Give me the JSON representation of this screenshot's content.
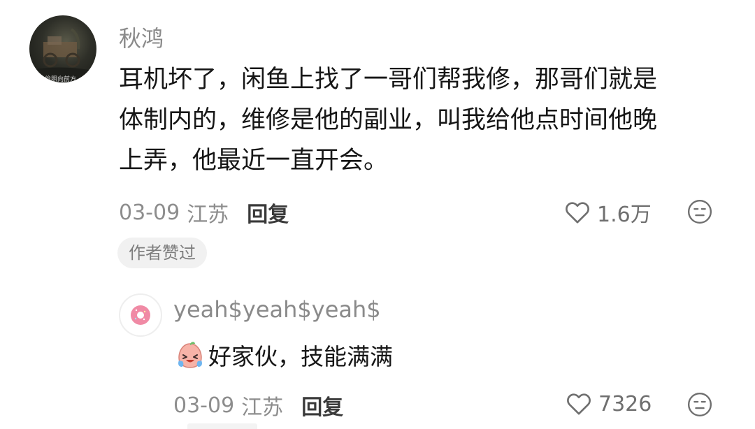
{
  "comment": {
    "username": "秋鸿",
    "avatar_watermark": "偷照向前方",
    "lines": [
      "耳机坏了，闲鱼上找了一哥们帮我修，那哥们就是",
      "体制内的，维修是他的副业，叫我给他点时间他晚",
      "上弄，他最近一直开会。"
    ],
    "date": "03-09",
    "location": "江苏",
    "reply_label": "回复",
    "like_count": "1.6万",
    "author_badge": "作者赞过"
  },
  "reply": {
    "username": "yeah$yeah$yeah$",
    "emoji": "crying-laughing-peach-emoji",
    "text": "好家伙，技能满满",
    "date": "03-09",
    "location": "江苏",
    "reply_label": "回复",
    "like_count": "7326"
  },
  "colors": {
    "username": "#8a8a8a",
    "content": "#161616",
    "meta": "#8d8d8d",
    "badge_bg": "#f1f1f1"
  }
}
